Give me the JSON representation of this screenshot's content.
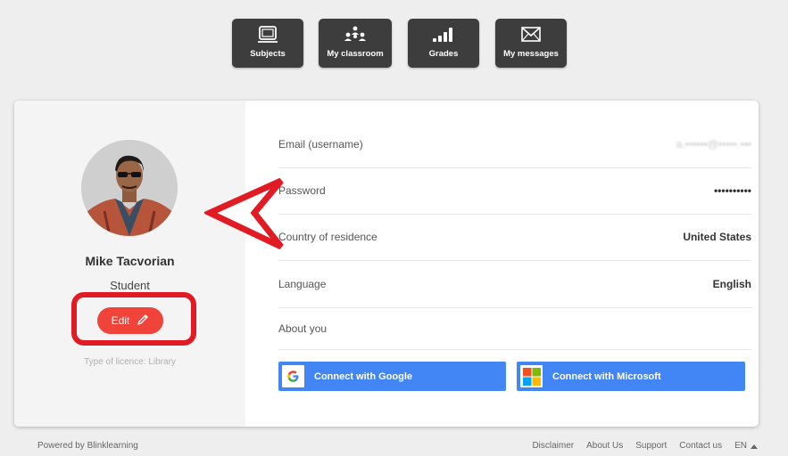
{
  "nav": {
    "items": [
      {
        "label": "Subjects",
        "icon": "subjects-icon"
      },
      {
        "label": "My classroom",
        "icon": "classroom-icon"
      },
      {
        "label": "Grades",
        "icon": "grades-icon"
      },
      {
        "label": "My messages",
        "icon": "messages-icon"
      }
    ]
  },
  "profile": {
    "name": "Mike Tacvorian",
    "role": "Student",
    "edit_label": "Edit",
    "licence": "Type of licence: Library"
  },
  "fields": [
    {
      "label": "Email (username)",
      "value": "a.••••••@•••••.•••"
    },
    {
      "label": "Password",
      "value": "••••••••••"
    },
    {
      "label": "Country of residence",
      "value": "United States"
    },
    {
      "label": "Language",
      "value": "English"
    },
    {
      "label": "About you",
      "value": ""
    }
  ],
  "connect": {
    "google_label": "Connect with Google",
    "microsoft_label": "Connect with Microsoft"
  },
  "footer": {
    "powered": "Powered by Blinklearning",
    "links": [
      "Disclaimer",
      "About Us",
      "Support",
      "Contact us"
    ],
    "lang": "EN"
  },
  "colors": {
    "accent": "#f0433a",
    "highlight": "#e01b24",
    "connect": "#4285f4",
    "nav_bg": "#3d3d3d"
  }
}
